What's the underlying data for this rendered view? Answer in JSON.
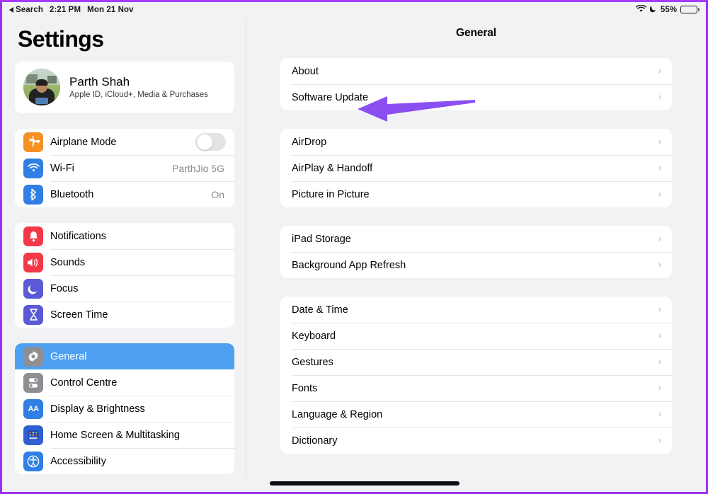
{
  "statusbar": {
    "back_label": "Search",
    "time": "2:21 PM",
    "date": "Mon 21 Nov",
    "battery_percent": "55%",
    "wifi_icon": "wifi-icon",
    "moon_icon": "do-not-disturb-icon",
    "battery_icon": "battery-icon",
    "battery_level": 55
  },
  "sidebar": {
    "title": "Settings",
    "profile": {
      "name": "Parth Shah",
      "subtitle": "Apple ID, iCloud+, Media & Purchases",
      "avatar_icon": "profile-photo"
    },
    "group_connectivity": [
      {
        "label": "Airplane Mode",
        "icon": "airplane-icon",
        "icon_color": "#f49122",
        "control": "toggle",
        "toggle_on": false
      },
      {
        "label": "Wi-Fi",
        "icon": "wifi-icon",
        "icon_color": "#2f7fe4",
        "value": "ParthJio 5G"
      },
      {
        "label": "Bluetooth",
        "icon": "bluetooth-icon",
        "icon_color": "#2f7fe4",
        "value": "On"
      }
    ],
    "group_alerts": [
      {
        "label": "Notifications",
        "icon": "notification-bell-icon",
        "icon_color": "#f4384a"
      },
      {
        "label": "Sounds",
        "icon": "speaker-icon",
        "icon_color": "#f4384a"
      },
      {
        "label": "Focus",
        "icon": "moon-icon",
        "icon_color": "#5a59d6"
      },
      {
        "label": "Screen Time",
        "icon": "hourglass-icon",
        "icon_color": "#5a59d6"
      }
    ],
    "group_system": [
      {
        "label": "General",
        "icon": "gear-icon",
        "icon_color": "#8e8e93",
        "selected": true
      },
      {
        "label": "Control Centre",
        "icon": "control-centre-icon",
        "icon_color": "#8e8e93",
        "selected": false
      },
      {
        "label": "Display & Brightness",
        "icon": "display-brightness-icon",
        "icon_color": "#2f7fe4",
        "selected": false
      },
      {
        "label": "Home Screen & Multitasking",
        "icon": "home-screen-icon",
        "icon_color": "#2f5fd0",
        "selected": false
      },
      {
        "label": "Accessibility",
        "icon": "accessibility-icon",
        "icon_color": "#2f7fe4",
        "selected": false
      }
    ]
  },
  "main": {
    "title": "General",
    "groups": [
      {
        "rows": [
          {
            "label": "About",
            "chevron": "chevron-right-icon"
          },
          {
            "label": "Software Update",
            "chevron": "chevron-right-icon",
            "annotated": true
          }
        ]
      },
      {
        "rows": [
          {
            "label": "AirDrop",
            "chevron": "chevron-right-icon"
          },
          {
            "label": "AirPlay & Handoff",
            "chevron": "chevron-right-icon"
          },
          {
            "label": "Picture in Picture",
            "chevron": "chevron-right-icon"
          }
        ]
      },
      {
        "rows": [
          {
            "label": "iPad Storage",
            "chevron": "chevron-right-icon"
          },
          {
            "label": "Background App Refresh",
            "chevron": "chevron-right-icon"
          }
        ]
      },
      {
        "rows": [
          {
            "label": "Date & Time",
            "chevron": "chevron-right-icon"
          },
          {
            "label": "Keyboard",
            "chevron": "chevron-right-icon"
          },
          {
            "label": "Gestures",
            "chevron": "chevron-right-icon"
          },
          {
            "label": "Fonts",
            "chevron": "chevron-right-icon"
          },
          {
            "label": "Language & Region",
            "chevron": "chevron-right-icon"
          },
          {
            "label": "Dictionary",
            "chevron": "chevron-right-icon"
          }
        ]
      }
    ]
  },
  "annotation": {
    "arrow_icon": "arrow-left-annotation",
    "color": "#8b4ef0",
    "points_to": "Software Update"
  },
  "colors": {
    "frame_purple": "#9a2ff0",
    "selection_blue": "#4ea1f2",
    "panel_background": "#f2f2f5",
    "card_white": "#ffffff",
    "chevron_gray": "#c2c2c6"
  },
  "home_indicator": {
    "label": "home-indicator"
  }
}
